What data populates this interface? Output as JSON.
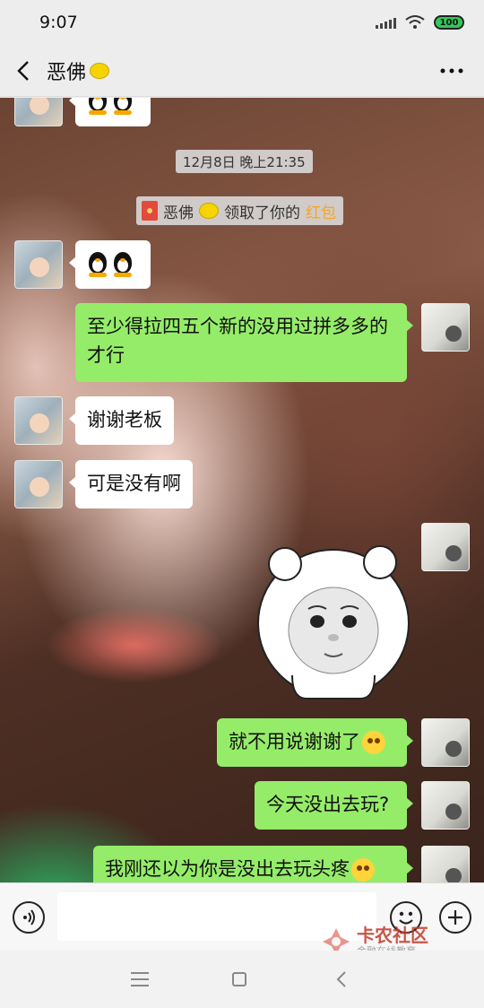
{
  "status_bar": {
    "time": "9:07",
    "battery": "100"
  },
  "header": {
    "title": "恶佛"
  },
  "chat": {
    "timestamp": "12月8日 晚上21:35",
    "system_notice": {
      "prefix": "恶佛",
      "text": "领取了你的",
      "link": "红包"
    },
    "messages": [
      {
        "side": "in",
        "text": "谢谢老板"
      },
      {
        "side": "in",
        "text": "可是没有啊"
      },
      {
        "side": "out",
        "text": "至少得拉四五个新的没用过拼多多的才行"
      },
      {
        "side": "out",
        "text": "就不用说谢谢了"
      },
      {
        "side": "out",
        "text": "今天没出去玩?"
      },
      {
        "side": "out",
        "text": "我刚还以为你是没出去玩头疼"
      }
    ]
  },
  "watermark": {
    "name": "卡农社区",
    "slogan": "金融在线教育"
  },
  "colors": {
    "outgoing_bubble": "#95ec69",
    "incoming_bubble": "#ffffff",
    "red_packet": "#f5a623"
  }
}
